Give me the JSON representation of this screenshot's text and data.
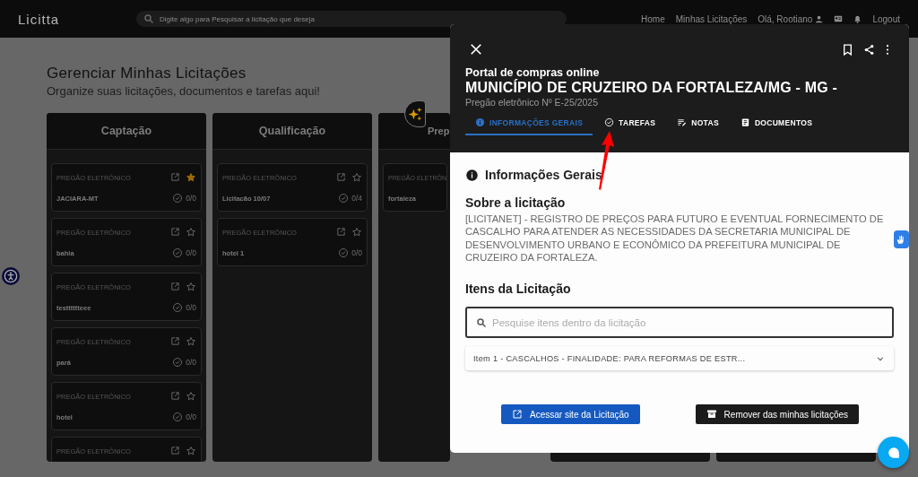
{
  "header": {
    "logo": "Licitta",
    "search": {
      "placeholder": "Digite algo para Pesquisar a licitação que deseja"
    },
    "nav": [
      {
        "label": "Home"
      },
      {
        "label": "Minhas Licitações"
      }
    ],
    "user": "Olá, Rootiano",
    "logout": "Logout"
  },
  "page": {
    "title": "Gerenciar Minhas Licitações",
    "subtitle": "Organize suas licitações, documentos e tarefas aqui!"
  },
  "columns": [
    {
      "title": "Captação",
      "cards": [
        {
          "type": "PREGÃO ELETRÔNICO",
          "name": "JACIARA-MT",
          "tasks": "0/0",
          "favorite": true
        },
        {
          "type": "PREGÃO ELETRÔNICO",
          "name": "bahia",
          "tasks": "0/0",
          "favorite": false
        },
        {
          "type": "PREGÃO ELETRÔNICO",
          "name": "testttttteee",
          "tasks": "0/0",
          "favorite": false
        },
        {
          "type": "PREGÃO ELETRÔNICO",
          "name": "pará",
          "tasks": "0/0",
          "favorite": false
        },
        {
          "type": "PREGÃO ELETRÔNICO",
          "name": "hotel",
          "tasks": "0/0",
          "favorite": false
        },
        {
          "type": "PREGÃO ELETRÔNICO",
          "favorite": false
        }
      ]
    },
    {
      "title": "Qualificação",
      "cards": [
        {
          "type": "PREGÃO ELETRÔNICO",
          "name": "Licitacão 10/07",
          "tasks": "0/4",
          "favorite": false
        },
        {
          "type": "PREGÃO ELETRÔNICO",
          "name": "hotel 1",
          "tasks": "0/0",
          "favorite": false
        }
      ]
    },
    {
      "title": "Prep",
      "cards": [
        {
          "type": "PREGÃO ELETRÔN",
          "name": "fortaleza"
        }
      ]
    },
    {},
    {}
  ],
  "modal": {
    "portal": "Portal de compras online",
    "org": "MUNICÍPIO DE CRUZEIRO DA FORTALEZA/MG - MG -",
    "process": "Pregão eletrônico Nº E-25/2025",
    "tabs": [
      {
        "label": "INFORMAÇÕES GERAIS",
        "selected": true
      },
      {
        "label": "TAREFAS",
        "selected": false
      },
      {
        "label": "NOTAS",
        "selected": false
      },
      {
        "label": "DOCUMENTOS",
        "selected": false
      }
    ],
    "section_title": "Informações Gerais",
    "about_title": "Sobre a licitação",
    "about_text": "[LICITANET] - REGISTRO DE PREÇOS PARA FUTURO E EVENTUAL FORNECIMENTO DE CASCALHO PARA ATENDER AS NECESSIDADES DA SECRETARIA MUNICIPAL DE DESENVOLVIMENTO URBANO E ECONÔMICO DA PREFEITURA MUNICIPAL DE CRUZEIRO DA FORTALEZA.",
    "items_title": "Itens da Licitação",
    "items_search": {
      "placeholder": "Pesquise itens dentro da licitação"
    },
    "items": [
      {
        "label": "Item 1 - CASCALHOS - FINALIDADE: PARA REFORMAS DE ESTR...",
        "expanded": false
      }
    ],
    "buttons": [
      {
        "label": "Acessar site da Licitação",
        "kind": "primary"
      },
      {
        "label": "Remover das minhas licitações",
        "kind": "dark"
      }
    ]
  }
}
